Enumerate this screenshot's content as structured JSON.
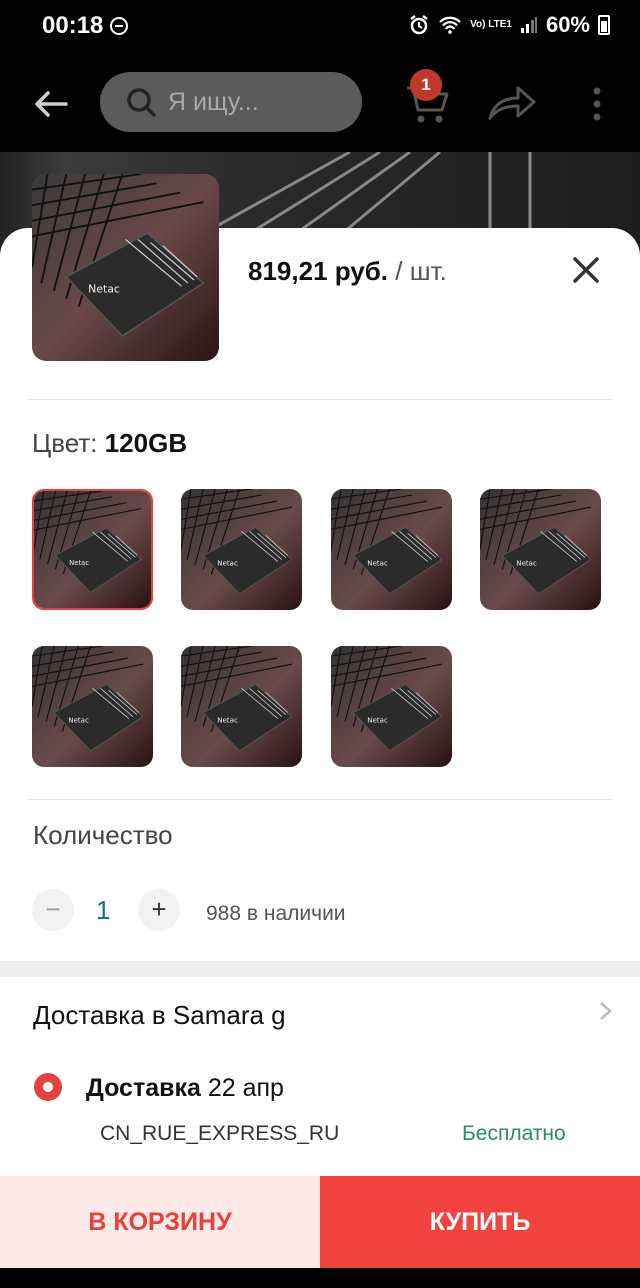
{
  "status_bar": {
    "time": "00:18",
    "network": "Vo) LTE1",
    "battery": "60%"
  },
  "top_bar": {
    "search_placeholder": "Я ищу...",
    "cart_count": "1"
  },
  "sheet": {
    "price": "819,21 руб.",
    "unit": "/ шт.",
    "color_label": "Цвет:",
    "color_value": "120GB",
    "variants_count": 7,
    "selected_variant": 1,
    "quantity_label": "Количество",
    "quantity": "1",
    "stock": "988 в наличии",
    "delivery_title": "Доставка в Samara g",
    "delivery_prefix": "Доставка",
    "delivery_date": "22 апр",
    "carrier": "CN_RUE_EXPRESS_RU",
    "delivery_price": "Бесплатно"
  },
  "actions": {
    "cart": "В КОРЗИНУ",
    "buy": "КУПИТЬ"
  },
  "colors": {
    "accent": "#E8403C",
    "free": "#2A8A6C",
    "qty": "#1C6F86"
  }
}
